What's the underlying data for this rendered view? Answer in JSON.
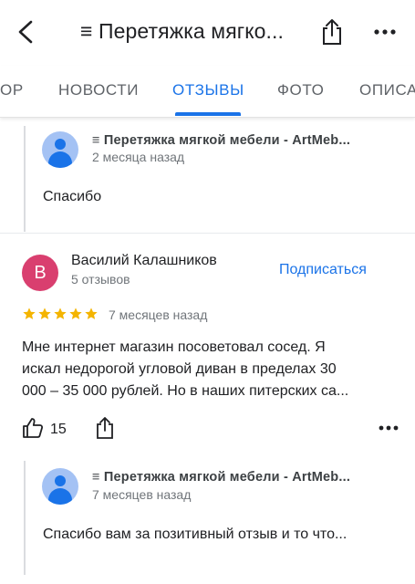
{
  "header": {
    "title": "≡ Перетяжка мягко...",
    "back_icon": "chevron-left-icon",
    "share_icon": "share-icon",
    "more_icon": "more-horizontal-icon"
  },
  "tabs": [
    {
      "label": "ОР"
    },
    {
      "label": "НОВОСТИ"
    },
    {
      "label": "ОТЗЫВЫ",
      "active": true
    },
    {
      "label": "ФОТО"
    },
    {
      "label": "ОПИСА"
    }
  ],
  "replies": [
    {
      "owner": "≡ Перетяжка мягкой мебели - ArtMeb...",
      "date": "2 месяца назад",
      "text": "Спасибо"
    },
    {
      "owner": "≡ Перетяжка мягкой мебели - ArtMeb...",
      "date": "7 месяцев назад",
      "text": "Спасибо вам за позитивный отзыв и то что..."
    }
  ],
  "review": {
    "avatar_letter": "В",
    "avatar_color": "#d93f6f",
    "name": "Василий Калашников",
    "reviews_count": "5 отзывов",
    "subscribe_label": "Подписаться",
    "rating": 5,
    "date": "7 месяцев назад",
    "text_lines": [
      "Мне интернет магазин посоветовал сосед. Я",
      "искал недорогой угловой диван в пределах 30",
      "000 – 35 000 рублей. Но в наших питерских са..."
    ],
    "likes": "15"
  },
  "colors": {
    "accent": "#1a73e8",
    "star": "#f4b400"
  }
}
